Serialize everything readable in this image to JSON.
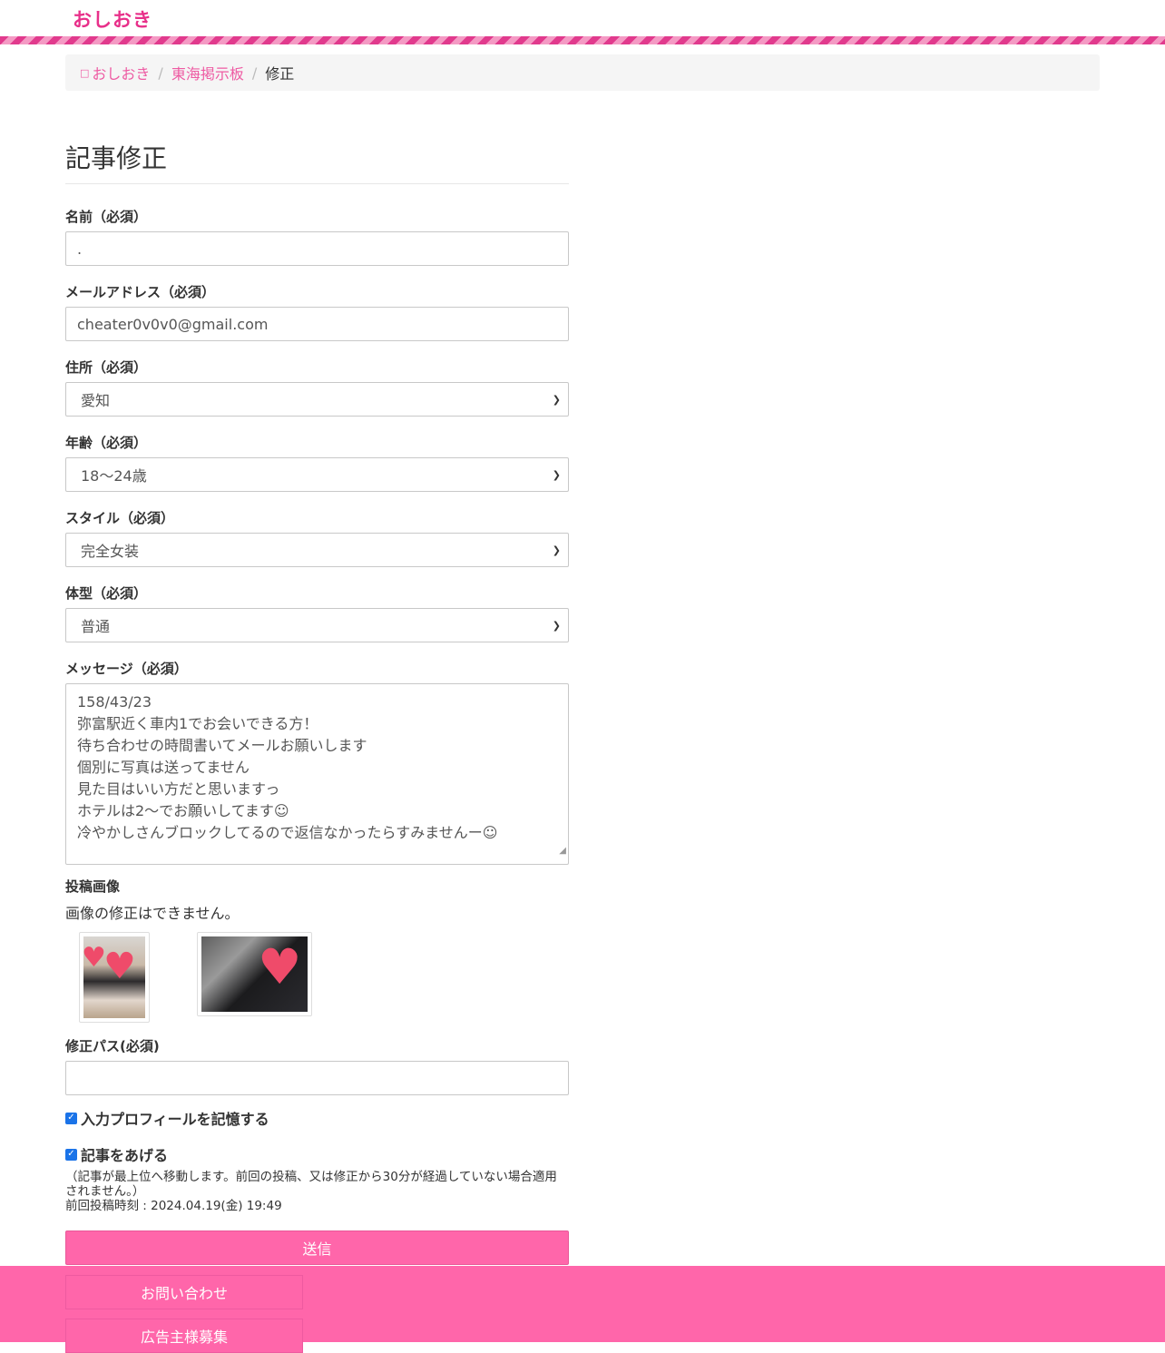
{
  "header": {
    "logo": "おしおき"
  },
  "breadcrumb": {
    "home": "おしおき",
    "board": "東海掲示板",
    "current": "修正"
  },
  "title": "記事修正",
  "form": {
    "name": {
      "label": "名前（必須）",
      "value": "."
    },
    "email": {
      "label": "メールアドレス（必須）",
      "value": "cheater0v0v0@gmail.com"
    },
    "address": {
      "label": "住所（必須）",
      "value": "愛知"
    },
    "age": {
      "label": "年齢（必須）",
      "value": "18〜24歳"
    },
    "style": {
      "label": "スタイル（必須）",
      "value": "完全女装"
    },
    "body": {
      "label": "体型（必須）",
      "value": "普通"
    },
    "message": {
      "label": "メッセージ（必須）",
      "lines": [
        "158/43/23",
        "弥富駅近く車内1でお会いできる方！",
        "待ち合わせの時間書いてメールお願いします",
        "個別に写真は送ってません",
        "見た目はいい方だと思いますっ",
        "ホテルは2〜でお願いしてます☺︎",
        "冷やかしさんブロックしてるので返信なかったらすみませんー☺︎"
      ]
    },
    "images": {
      "label": "投稿画像",
      "note": "画像の修正はできません。"
    },
    "password": {
      "label": "修正パス(必須)",
      "value": ""
    },
    "remember": {
      "label": "入力プロフィールを記憶する",
      "checked": true
    },
    "bump": {
      "label": "記事をあげる",
      "checked": true,
      "note": "（記事が最上位へ移動します。前回の投稿、又は修正から30分が経過していない場合適用されません。）",
      "last_post": "前回投稿時刻 : 2024.04.19(金) 19:49"
    },
    "submit": "送信"
  },
  "footer": {
    "contact": "お問い合わせ",
    "ads": "広告主様募集"
  },
  "colors": {
    "accent": "#ff66aa",
    "logo": "#e8308a",
    "link": "#ee5ba3"
  }
}
